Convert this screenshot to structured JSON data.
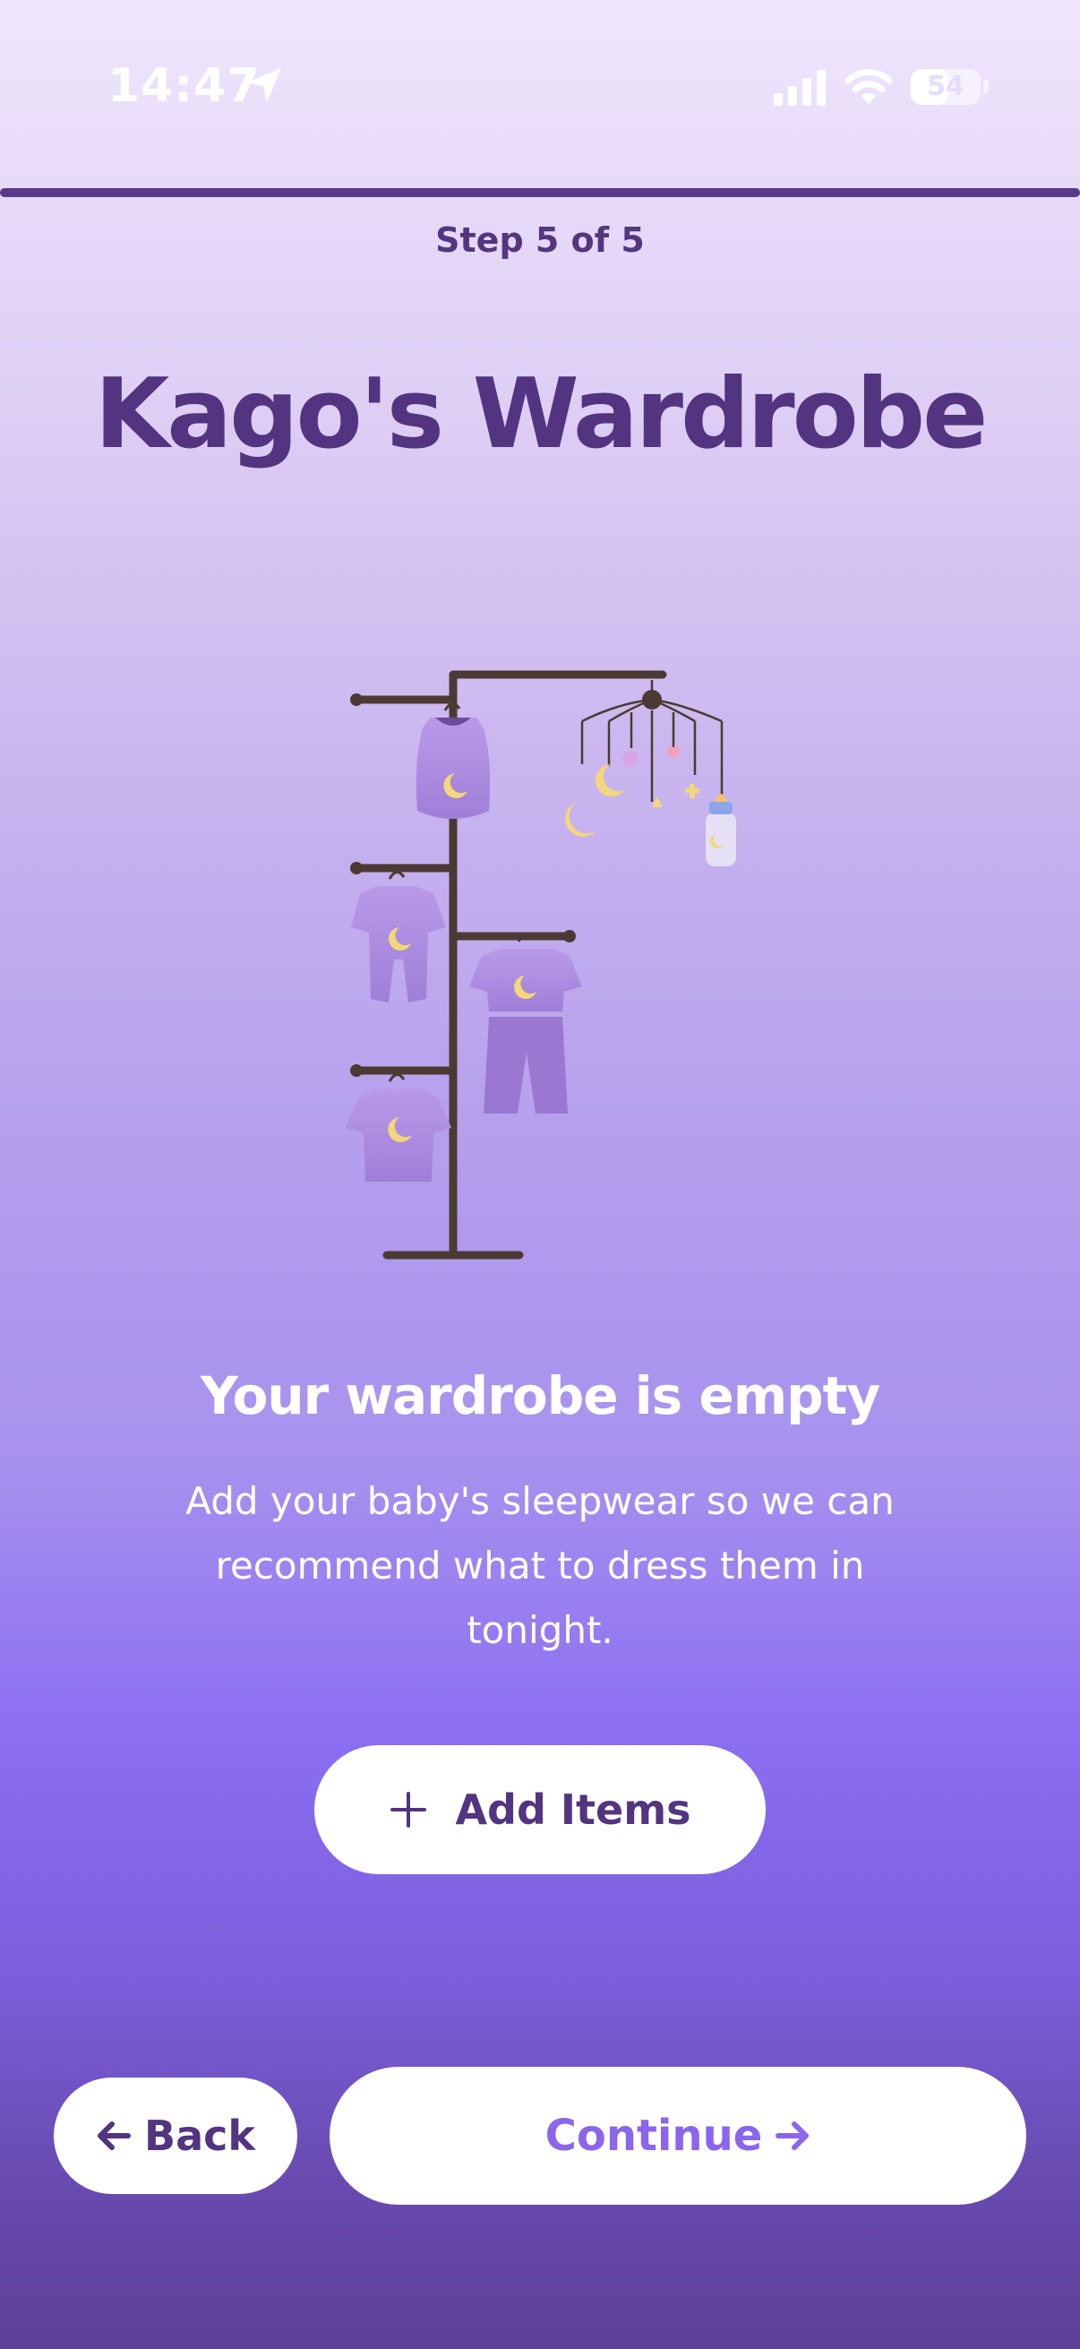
{
  "status_bar": {
    "time": "14:47",
    "battery_percent": "54",
    "battery_level": 0.54,
    "icons": [
      "location-arrow-icon",
      "cellular-signal-icon",
      "wifi-icon",
      "battery-icon"
    ]
  },
  "progress": {
    "step_label": "Step 5 of 5",
    "fraction": 1.0
  },
  "header": {
    "title": "Kago's Wardrobe"
  },
  "illustration": {
    "icon": "clothing-rack-illustration"
  },
  "empty_state": {
    "heading": "Your wardrobe is empty",
    "description": "Add your baby's sleepwear so we can recommend what to dress them in tonight."
  },
  "add_items": {
    "label": "Add Items",
    "icon": "plus-icon"
  },
  "nav": {
    "back_label": "Back",
    "back_icon": "arrow-left-icon",
    "continue_label": "Continue",
    "continue_icon": "arrow-right-icon"
  },
  "colors": {
    "primary_text": "#523480",
    "accent": "#8a66ec",
    "button_bg": "#ffffff"
  }
}
